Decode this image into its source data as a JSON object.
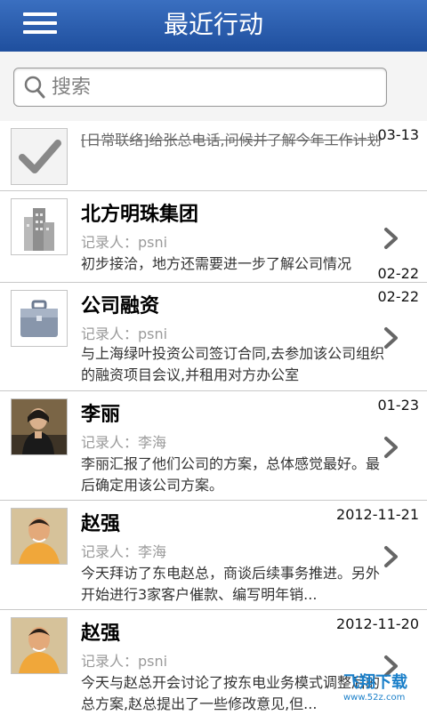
{
  "header": {
    "title": "最近行动",
    "menu_icon": "hamburger-menu-icon"
  },
  "search": {
    "placeholder": "搜索",
    "icon": "search-icon"
  },
  "items": [
    {
      "type": "done",
      "text": "[日常联络]给张总电话,问候并了解今年工作计划",
      "date": "03-13",
      "icon": "checkmark-icon"
    },
    {
      "name": "北方明珠集团",
      "date": "02-22",
      "recorder_label": "记录人：psni",
      "desc": "初步接洽，地方还需要进一步了解公司情况",
      "icon": "building-icon"
    },
    {
      "name": "公司融资",
      "date": "02-22",
      "recorder_label": "记录人：psni",
      "desc": "与上海绿叶投资公司签订合同,去参加该公司组织的融资项目会议,并租用对方办公室",
      "icon": "briefcase-icon"
    },
    {
      "name": "李丽",
      "date": "01-23",
      "recorder_label": "记录人：李海",
      "desc": "李丽汇报了他们公司的方案，总体感觉最好。最后确定用该公司方案。",
      "icon": "avatar-photo"
    },
    {
      "name": "赵强",
      "date": "2012-11-21",
      "recorder_label": "记录人：李海",
      "desc": "今天拜访了东电赵总，商谈后续事务推进。另外开始进行3家客户催款、编写明年销...",
      "icon": "avatar-photo"
    },
    {
      "name": "赵强",
      "date": "2012-11-20",
      "recorder_label": "记录人：psni",
      "desc": "今天与赵总开会讨论了按东电业务模式调整后的总方案,赵总提出了一些修改意见,但...",
      "icon": "avatar-photo"
    }
  ],
  "watermark": {
    "text": "飞翔下载",
    "sub": "www.52z.com"
  }
}
